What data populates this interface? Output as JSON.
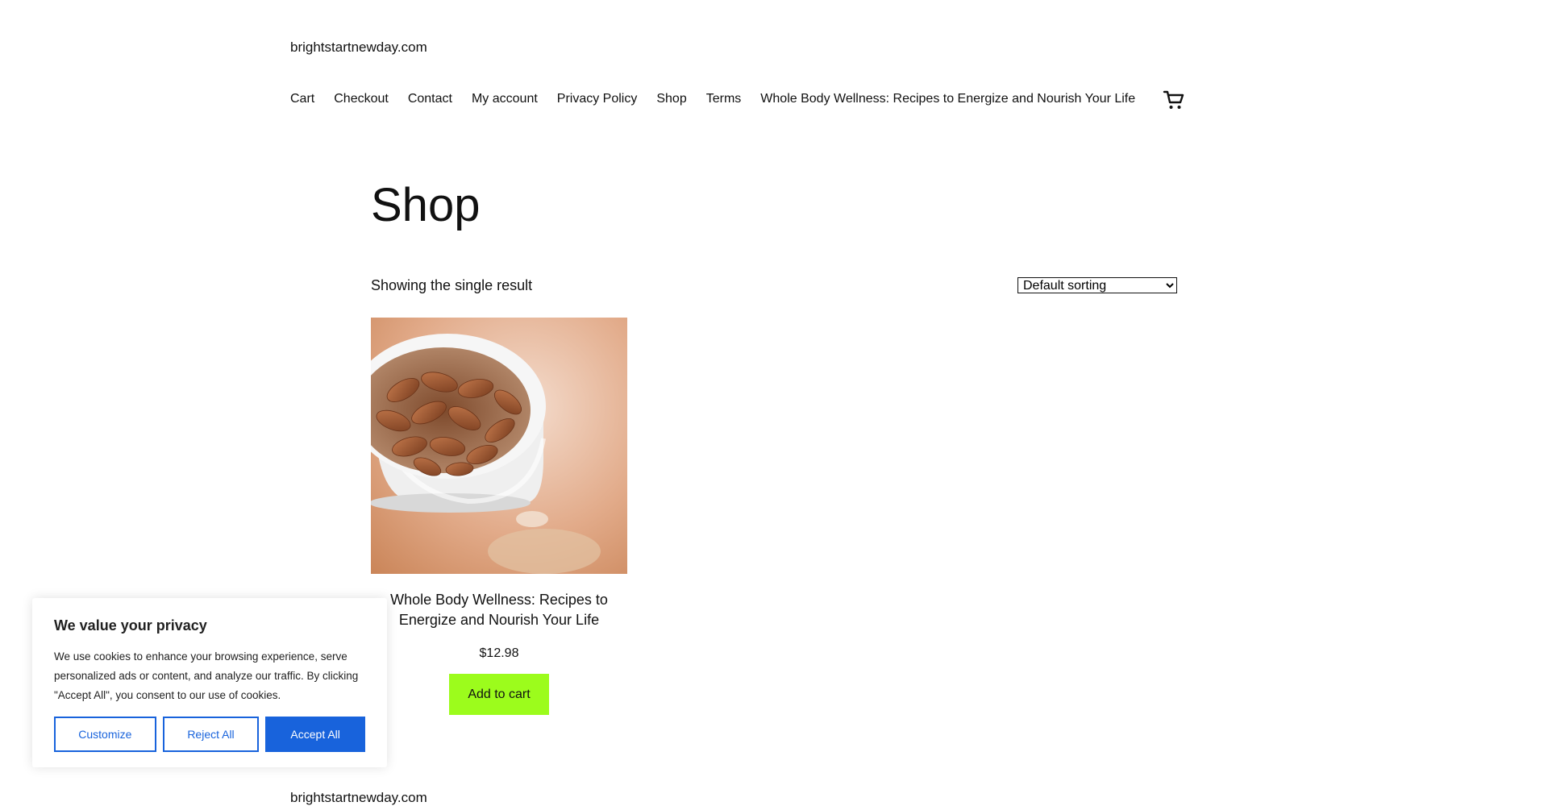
{
  "site": {
    "title": "brightstartnewday.com"
  },
  "nav": {
    "items": [
      {
        "label": "Cart"
      },
      {
        "label": "Checkout"
      },
      {
        "label": "Contact"
      },
      {
        "label": "My account"
      },
      {
        "label": "Privacy Policy"
      },
      {
        "label": "Shop"
      },
      {
        "label": "Terms"
      },
      {
        "label": "Whole Body Wellness: Recipes to Energize and Nourish Your Life"
      }
    ],
    "cart_icon": "cart-icon"
  },
  "main": {
    "title": "Shop",
    "result_count": "Showing the single result",
    "sorting": {
      "selected": "Default sorting"
    }
  },
  "product": {
    "image_icon": "almonds-in-bowl-image",
    "name": "Whole Body Wellness: Recipes to Energize and Nourish Your Life",
    "price": "$12.98",
    "add_to_cart_label": "Add to cart"
  },
  "footer": {
    "title": "brightstartnewday.com"
  },
  "cookie_banner": {
    "title": "We value your privacy",
    "text": "We use cookies to enhance your browsing experience, serve personalized ads or content, and analyze our traffic. By clicking \"Accept All\", you consent to our use of cookies.",
    "customize_label": "Customize",
    "reject_label": "Reject All",
    "accept_label": "Accept All"
  },
  "colors": {
    "add_to_cart_bg": "#9cfc1c",
    "cookie_accent": "#1863dc"
  }
}
